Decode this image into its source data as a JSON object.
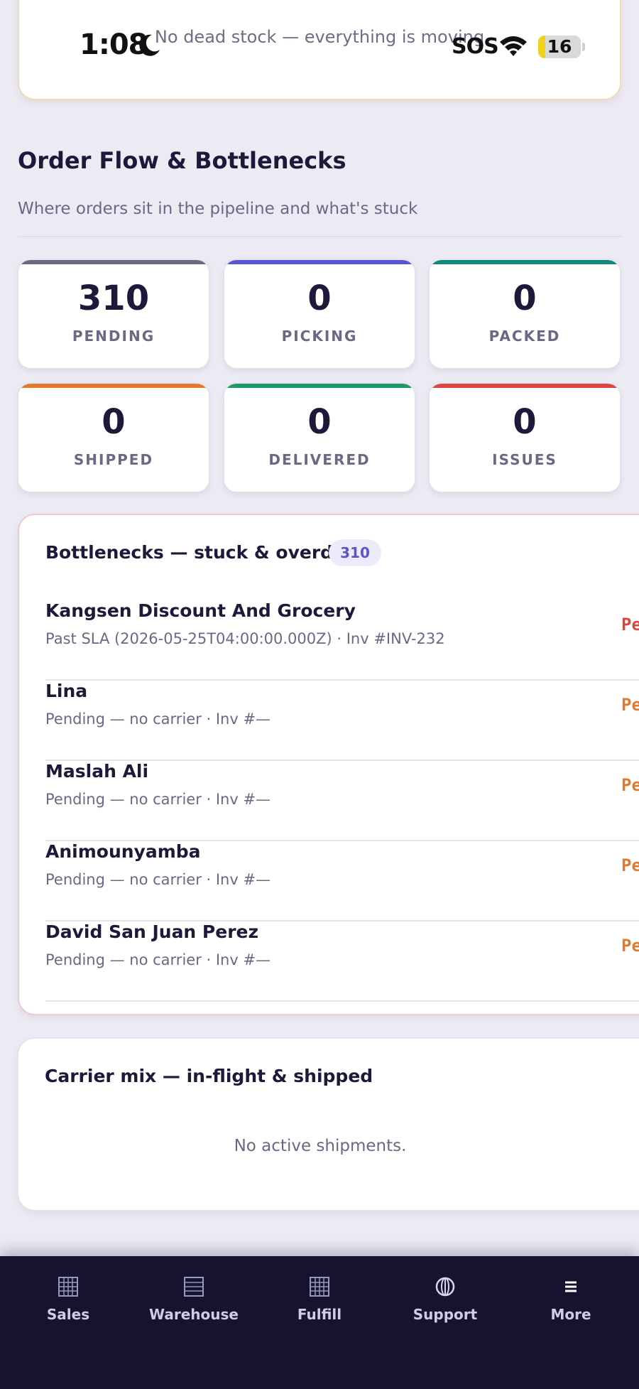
{
  "status_bar": {
    "time": "1:08",
    "sos": "SOS",
    "battery": "16",
    "battery_level": 0.16
  },
  "dead_stock": {
    "message": "No dead stock — everything is moving"
  },
  "section": {
    "title": "Order Flow & Bottlenecks",
    "subtitle": "Where orders sit in the pipeline and what's stuck"
  },
  "stats": [
    {
      "value": "310",
      "label": "PENDING",
      "color": "#6b6882"
    },
    {
      "value": "0",
      "label": "PICKING",
      "color": "#5a55d6"
    },
    {
      "value": "0",
      "label": "PACKED",
      "color": "#13877a"
    },
    {
      "value": "0",
      "label": "SHIPPED",
      "color": "#e07a2f"
    },
    {
      "value": "0",
      "label": "DELIVERED",
      "color": "#1f9a62"
    },
    {
      "value": "0",
      "label": "ISSUES",
      "color": "#d9483f"
    }
  ],
  "bottlenecks": {
    "title": "Bottlenecks — stuck & overdue",
    "count": "310",
    "rows": [
      {
        "name": "Kangsen Discount And Grocery",
        "detail": "Past SLA (2026-05-25T04:00:00.000Z) · Inv #INV-232",
        "status": "Pe",
        "status_color": "#d9483f"
      },
      {
        "name": "Lina",
        "detail": "Pending — no carrier · Inv #—",
        "status": "Pe",
        "status_color": "#e07a2f"
      },
      {
        "name": "Maslah Ali",
        "detail": "Pending — no carrier · Inv #—",
        "status": "Pe",
        "status_color": "#e07a2f"
      },
      {
        "name": "Animounyamba",
        "detail": "Pending — no carrier · Inv #—",
        "status": "Pe",
        "status_color": "#e07a2f"
      },
      {
        "name": "David San Juan Perez",
        "detail": "Pending — no carrier · Inv #—",
        "status": "Pe",
        "status_color": "#e07a2f"
      }
    ]
  },
  "carrier_mix": {
    "title": "Carrier mix — in-flight & shipped",
    "empty": "No active shipments."
  },
  "nav": [
    {
      "label": "Sales",
      "icon": "grid-icon"
    },
    {
      "label": "Warehouse",
      "icon": "list-icon"
    },
    {
      "label": "Fulfill",
      "icon": "grid-icon"
    },
    {
      "label": "Support",
      "icon": "globe-icon"
    },
    {
      "label": "More",
      "icon": "menu-icon"
    }
  ]
}
